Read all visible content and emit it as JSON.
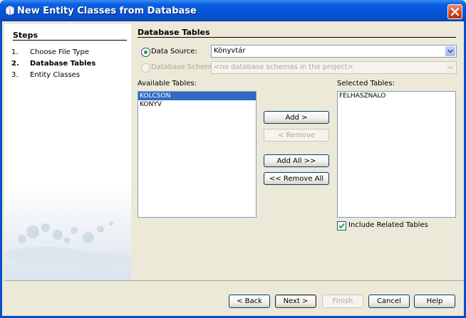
{
  "window": {
    "title": "New Entity Classes from Database",
    "icon": "netbeans-icon"
  },
  "steps": {
    "heading": "Steps",
    "items": [
      {
        "num": "1.",
        "label": "Choose File Type",
        "active": false
      },
      {
        "num": "2.",
        "label": "Database Tables",
        "active": true
      },
      {
        "num": "3.",
        "label": "Entity Classes",
        "active": false
      }
    ]
  },
  "main": {
    "heading": "Database Tables",
    "data_source": {
      "label": "Data Source:",
      "value": "Könyvtár",
      "selected": true
    },
    "database_schema": {
      "label": "Database Schema",
      "value": "<no database schemas in the project>",
      "selected": false,
      "enabled": false
    },
    "available": {
      "label": "Available Tables:",
      "items": [
        "KOLCSON",
        "KONYV"
      ],
      "selected_index": 0
    },
    "selected": {
      "label": "Selected Tables:",
      "items": [
        "FELHASZNALO"
      ]
    },
    "buttons": {
      "add": "Add >",
      "remove": "< Remove",
      "add_all": "Add All >>",
      "remove_all": "<< Remove All"
    },
    "include_related": {
      "label": "Include Related Tables",
      "checked": true
    }
  },
  "footer": {
    "back": "< Back",
    "next": "Next >",
    "finish": "Finish",
    "cancel": "Cancel",
    "help": "Help"
  },
  "colors": {
    "titlebar": "#0554d8",
    "selection": "#316ac5",
    "dialog_bg": "#ece9d8"
  }
}
